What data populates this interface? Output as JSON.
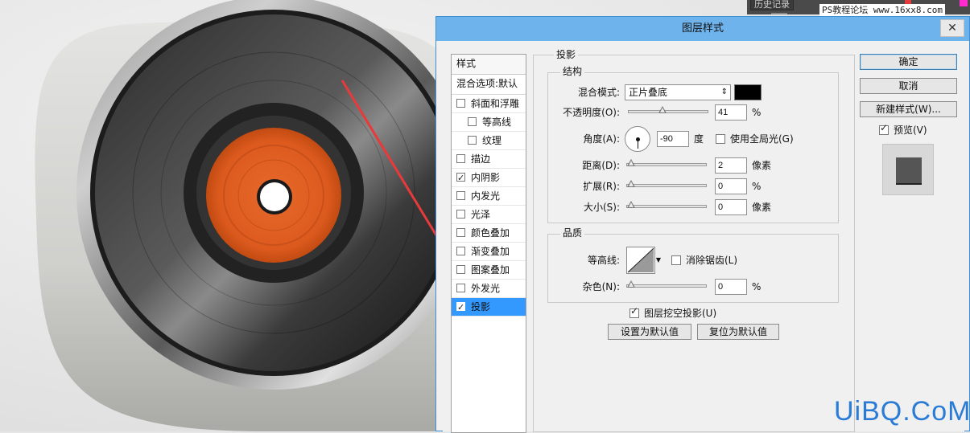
{
  "watermark_top": "PS教程论坛 www.16xx8.com",
  "watermark_bottom": "UiBQ.CoM",
  "top_panel": {
    "tab_label": "历史记录"
  },
  "dialog": {
    "title": "图层样式",
    "close_glyph": "✕",
    "styles": {
      "header": "样式",
      "blend_options": "混合选项:默认",
      "items": [
        {
          "label": "斜面和浮雕",
          "checked": false,
          "indent": 0,
          "selected": false
        },
        {
          "label": "等高线",
          "checked": false,
          "indent": 1,
          "selected": false
        },
        {
          "label": "纹理",
          "checked": false,
          "indent": 1,
          "selected": false
        },
        {
          "label": "描边",
          "checked": false,
          "indent": 0,
          "selected": false
        },
        {
          "label": "内阴影",
          "checked": true,
          "indent": 0,
          "selected": false
        },
        {
          "label": "内发光",
          "checked": false,
          "indent": 0,
          "selected": false
        },
        {
          "label": "光泽",
          "checked": false,
          "indent": 0,
          "selected": false
        },
        {
          "label": "颜色叠加",
          "checked": false,
          "indent": 0,
          "selected": false
        },
        {
          "label": "渐变叠加",
          "checked": false,
          "indent": 0,
          "selected": false
        },
        {
          "label": "图案叠加",
          "checked": false,
          "indent": 0,
          "selected": false
        },
        {
          "label": "外发光",
          "checked": false,
          "indent": 0,
          "selected": false
        },
        {
          "label": "投影",
          "checked": true,
          "indent": 0,
          "selected": true
        }
      ]
    },
    "drop_shadow": {
      "section_title": "投影",
      "structure": {
        "title": "结构",
        "blend_mode_label": "混合模式:",
        "blend_mode_value": "正片叠底",
        "shadow_color": "#000000",
        "opacity_label": "不透明度(O):",
        "opacity_value": "41",
        "opacity_level": 0.41,
        "percent": "%",
        "angle_label": "角度(A):",
        "angle_value": "-90",
        "angle_unit": "度",
        "global_light_label": "使用全局光(G)",
        "global_light_checked": false,
        "distance_label": "距离(D):",
        "distance_value": "2",
        "distance_level": 0.0,
        "pixel_unit": "像素",
        "spread_label": "扩展(R):",
        "spread_value": "0",
        "spread_level": 0.0,
        "size_label": "大小(S):",
        "size_value": "0",
        "size_level": 0.0
      },
      "quality": {
        "title": "品质",
        "contour_label": "等高线:",
        "anti_alias_label": "消除锯齿(L)",
        "anti_alias_checked": false,
        "noise_label": "杂色(N):",
        "noise_value": "0",
        "noise_level": 0.0
      },
      "knockout_label": "图层挖空投影(U)",
      "knockout_checked": true,
      "make_default_label": "设置为默认值",
      "reset_default_label": "复位为默认值"
    },
    "buttons": {
      "ok": "确定",
      "cancel": "取消",
      "new_style": "新建样式(W)...",
      "preview_label": "预览(V)",
      "preview_checked": true
    }
  }
}
